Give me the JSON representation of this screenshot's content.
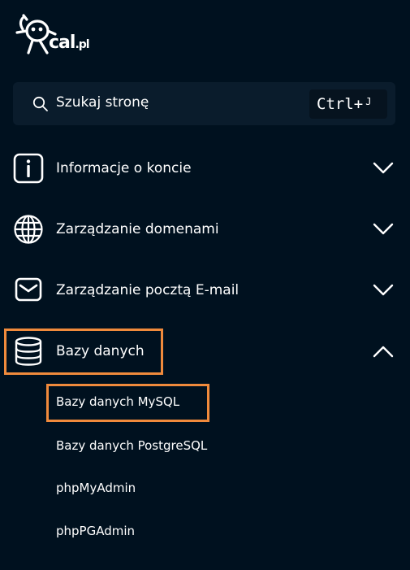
{
  "logo": {
    "name": "cal",
    "suffix": ".pl"
  },
  "search": {
    "label": "Szukaj stronę",
    "shortcut_main": "Ctrl+",
    "shortcut_key": "J"
  },
  "nav": [
    {
      "label": "Informacje o koncie",
      "icon": "info-icon",
      "expanded": false
    },
    {
      "label": "Zarządzanie domenami",
      "icon": "globe-icon",
      "expanded": false
    },
    {
      "label": "Zarządzanie pocztą E-mail",
      "icon": "envelope-icon",
      "expanded": false
    },
    {
      "label": "Bazy danych",
      "icon": "database-icon",
      "expanded": true,
      "highlighted": true
    }
  ],
  "submenu": [
    {
      "label": "Bazy danych MySQL",
      "highlighted": true
    },
    {
      "label": "Bazy danych PostgreSQL"
    },
    {
      "label": "phpMyAdmin"
    },
    {
      "label": "phpPGAdmin"
    }
  ],
  "colors": {
    "background": "#00111f",
    "search_bg": "#0a1c2c",
    "highlight": "#f08a3c",
    "text": "#ffffff"
  }
}
